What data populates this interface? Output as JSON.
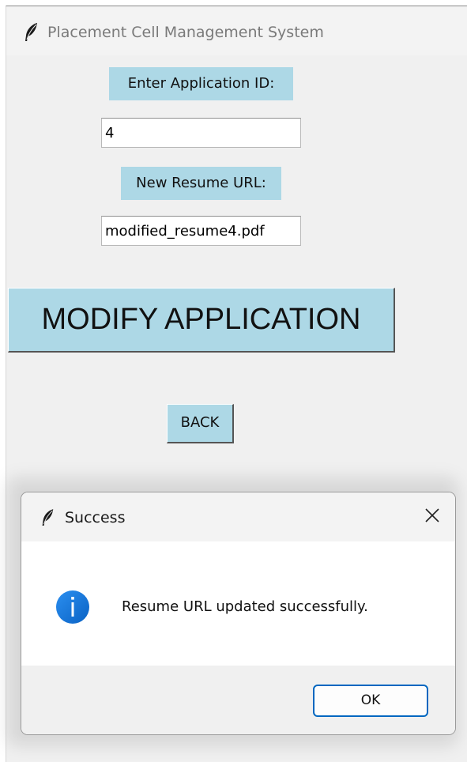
{
  "window": {
    "title": "Placement Cell Management System",
    "icon": "feather-icon"
  },
  "form": {
    "app_id_label": "Enter Application ID:",
    "app_id_value": "4",
    "resume_label": "New Resume URL:",
    "resume_value": "modified_resume4.pdf"
  },
  "buttons": {
    "modify_label": "MODIFY APPLICATION",
    "back_label": "BACK"
  },
  "dialog": {
    "title": "Success",
    "icon": "feather-icon",
    "close_icon": "close-icon",
    "info_icon": "info-icon",
    "message": "Resume URL updated successfully.",
    "ok_label": "OK"
  },
  "colors": {
    "accent": "#add8e6",
    "info_blue": "#0a74d6",
    "ok_border": "#0067c0"
  }
}
